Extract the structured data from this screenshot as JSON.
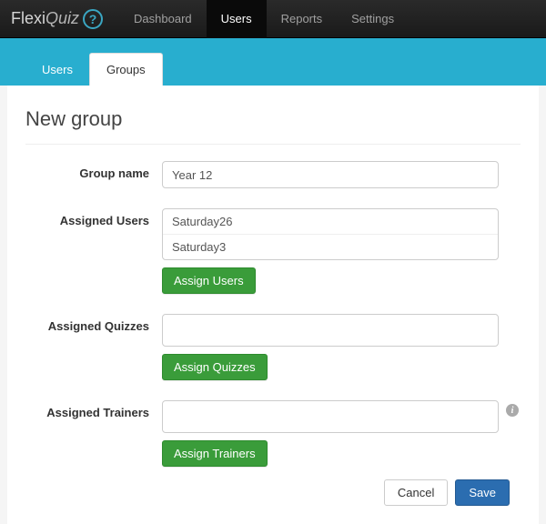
{
  "logo": {
    "part1": "Flexi",
    "part2": "Quiz"
  },
  "topnav": {
    "items": [
      {
        "label": "Dashboard"
      },
      {
        "label": "Users"
      },
      {
        "label": "Reports"
      },
      {
        "label": "Settings"
      }
    ],
    "active_index": 1
  },
  "subnav": {
    "tabs": [
      {
        "label": "Users"
      },
      {
        "label": "Groups"
      }
    ],
    "active_index": 1
  },
  "page": {
    "title": "New group"
  },
  "form": {
    "group_name": {
      "label": "Group name",
      "value": "Year 12"
    },
    "assigned_users": {
      "label": "Assigned Users",
      "items": [
        "Saturday26",
        "Saturday3"
      ],
      "button": "Assign Users"
    },
    "assigned_quizzes": {
      "label": "Assigned Quizzes",
      "items": [],
      "button": "Assign Quizzes"
    },
    "assigned_trainers": {
      "label": "Assigned Trainers",
      "items": [],
      "button": "Assign Trainers"
    }
  },
  "footer": {
    "cancel": "Cancel",
    "save": "Save"
  }
}
